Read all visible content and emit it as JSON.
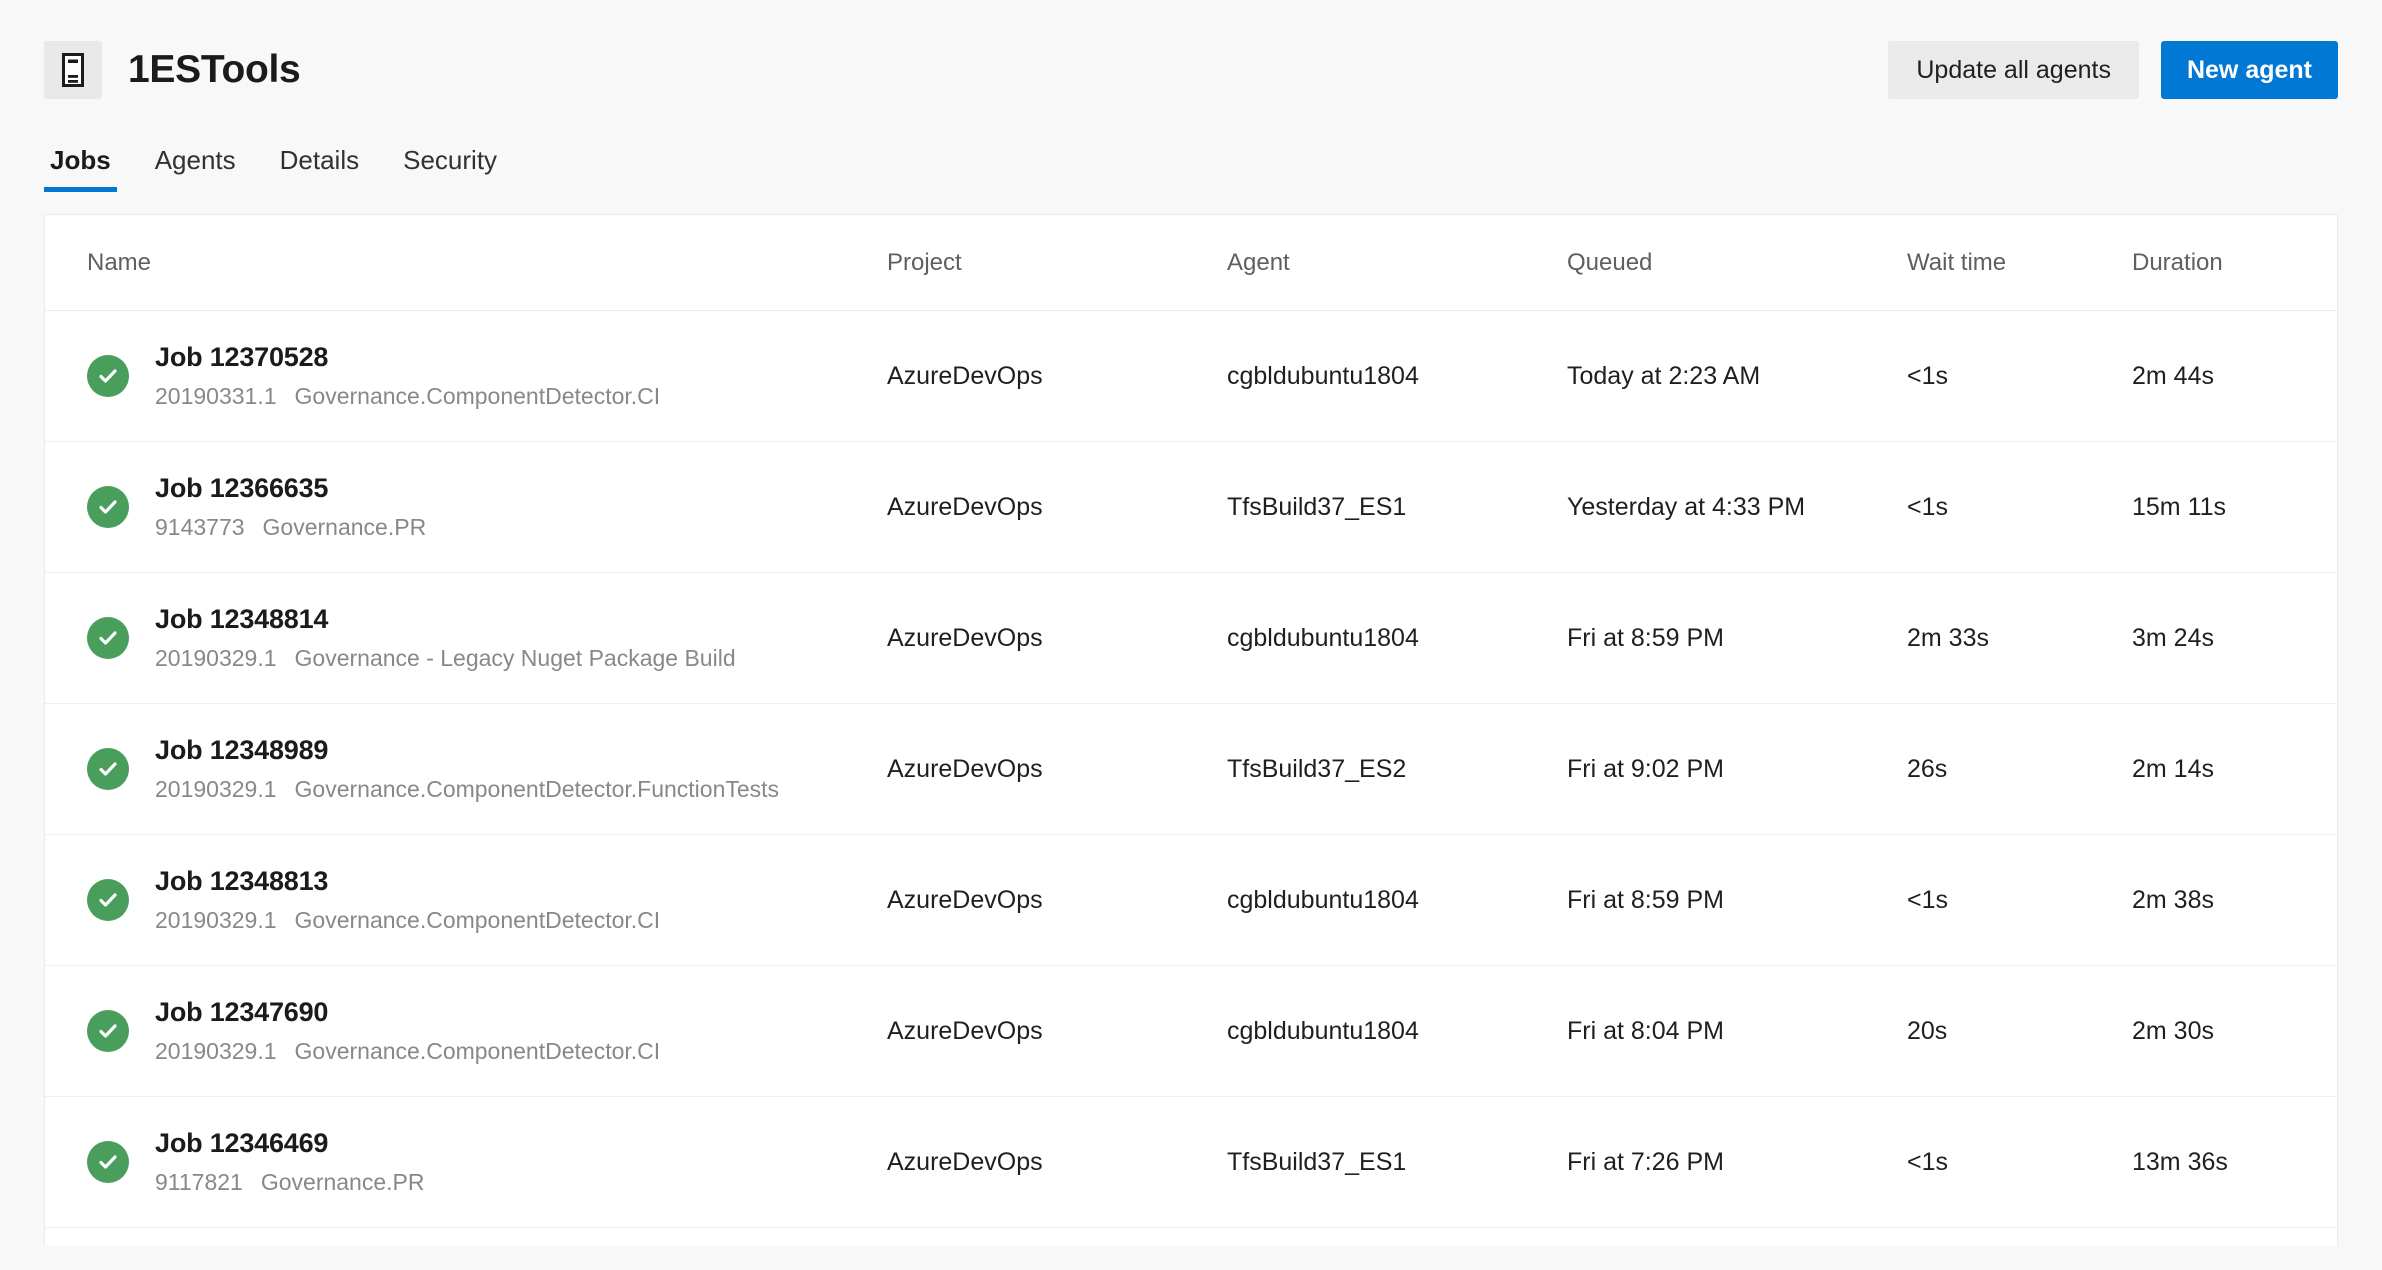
{
  "header": {
    "app_icon": "server-rack-icon",
    "title": "1ESTools",
    "update_all_agents_label": "Update all agents",
    "new_agent_label": "New agent",
    "primary_color": "#0078d4",
    "secondary_button_color": "#eaeaea"
  },
  "tabs": [
    {
      "label": "Jobs",
      "active": true
    },
    {
      "label": "Agents",
      "active": false
    },
    {
      "label": "Details",
      "active": false
    },
    {
      "label": "Security",
      "active": false
    }
  ],
  "table": {
    "columns": [
      "Name",
      "Project",
      "Agent",
      "Queued",
      "Wait time",
      "Duration"
    ],
    "status_color": "#4a9e5c",
    "rows": [
      {
        "status": "succeeded-check-icon",
        "job_name": "Job 12370528",
        "build_number": "20190331.1",
        "definition": "Governance.ComponentDetector.CI",
        "project": "AzureDevOps",
        "agent": "cgbldubuntu1804",
        "queued": "Today at 2:23 AM",
        "wait_time": "<1s",
        "duration": "2m 44s"
      },
      {
        "status": "succeeded-check-icon",
        "job_name": "Job 12366635",
        "build_number": "9143773",
        "definition": "Governance.PR",
        "project": "AzureDevOps",
        "agent": "TfsBuild37_ES1",
        "queued": "Yesterday at 4:33 PM",
        "wait_time": "<1s",
        "duration": "15m 11s"
      },
      {
        "status": "succeeded-check-icon",
        "job_name": "Job 12348814",
        "build_number": "20190329.1",
        "definition": "Governance - Legacy Nuget Package Build",
        "project": "AzureDevOps",
        "agent": "cgbldubuntu1804",
        "queued": "Fri at 8:59 PM",
        "wait_time": "2m 33s",
        "duration": "3m 24s"
      },
      {
        "status": "succeeded-check-icon",
        "job_name": "Job 12348989",
        "build_number": "20190329.1",
        "definition": "Governance.ComponentDetector.FunctionTests",
        "project": "AzureDevOps",
        "agent": "TfsBuild37_ES2",
        "queued": "Fri at 9:02 PM",
        "wait_time": "26s",
        "duration": "2m 14s"
      },
      {
        "status": "succeeded-check-icon",
        "job_name": "Job 12348813",
        "build_number": "20190329.1",
        "definition": "Governance.ComponentDetector.CI",
        "project": "AzureDevOps",
        "agent": "cgbldubuntu1804",
        "queued": "Fri at 8:59 PM",
        "wait_time": "<1s",
        "duration": "2m 38s"
      },
      {
        "status": "succeeded-check-icon",
        "job_name": "Job 12347690",
        "build_number": "20190329.1",
        "definition": "Governance.ComponentDetector.CI",
        "project": "AzureDevOps",
        "agent": "cgbldubuntu1804",
        "queued": "Fri at 8:04 PM",
        "wait_time": "20s",
        "duration": "2m 30s"
      },
      {
        "status": "succeeded-check-icon",
        "job_name": "Job 12346469",
        "build_number": "9117821",
        "definition": "Governance.PR",
        "project": "AzureDevOps",
        "agent": "TfsBuild37_ES1",
        "queued": "Fri at 7:26 PM",
        "wait_time": "<1s",
        "duration": "13m 36s"
      }
    ]
  }
}
